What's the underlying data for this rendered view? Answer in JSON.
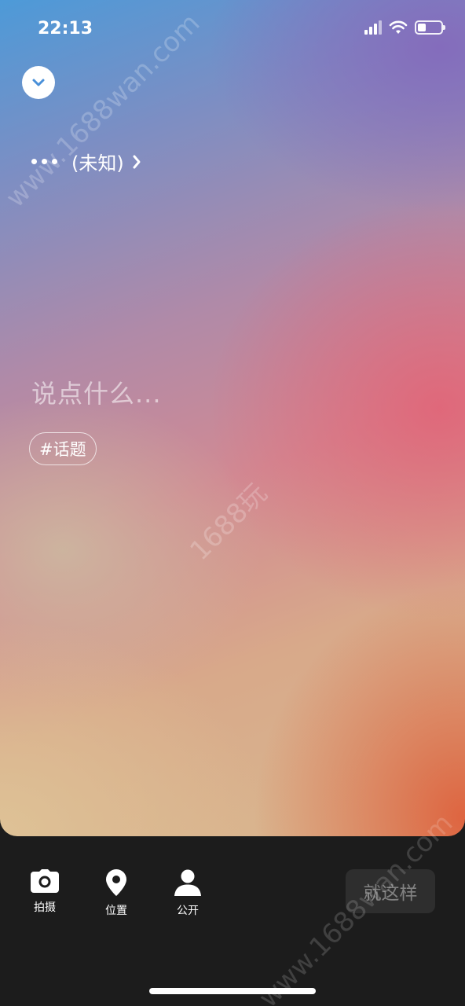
{
  "status": {
    "time": "22:13"
  },
  "location": {
    "label": "(未知)"
  },
  "compose": {
    "placeholder": "说点什么..."
  },
  "topic": {
    "label": "#话题"
  },
  "toolbar": {
    "camera_label": "拍摄",
    "location_label": "位置",
    "privacy_label": "公开",
    "submit_label": "就这样"
  },
  "watermarks": {
    "top": "www.1688wan.com",
    "center": "1688玩",
    "bottom": "www.1688wan.com"
  },
  "colors": {
    "toolbar_bg": "#1c1c1c",
    "accent_blue": "#4a90d9"
  }
}
